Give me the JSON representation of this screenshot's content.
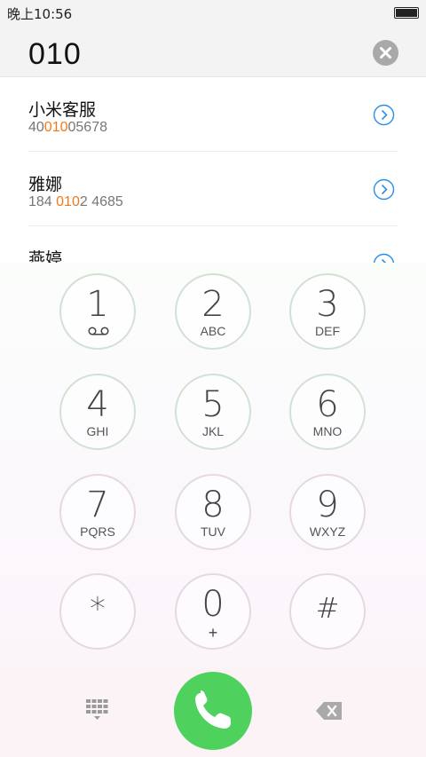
{
  "status_bar": {
    "time": "晚上10:56"
  },
  "dialer": {
    "input": "010"
  },
  "results": [
    {
      "name": "小米客服",
      "number_pre": "40",
      "number_match": "010",
      "number_post": "05678"
    },
    {
      "name": "雅娜",
      "number_pre": "184 ",
      "number_match": "010",
      "number_post": "2 4685"
    },
    {
      "name": "燕婷",
      "number_pre": "",
      "number_match": "",
      "number_post": ""
    }
  ],
  "keypad": [
    {
      "digit": "1",
      "letters": ""
    },
    {
      "digit": "2",
      "letters": "ABC"
    },
    {
      "digit": "3",
      "letters": "DEF"
    },
    {
      "digit": "4",
      "letters": "GHI"
    },
    {
      "digit": "5",
      "letters": "JKL"
    },
    {
      "digit": "6",
      "letters": "MNO"
    },
    {
      "digit": "7",
      "letters": "PQRS"
    },
    {
      "digit": "8",
      "letters": "TUV"
    },
    {
      "digit": "9",
      "letters": "WXYZ"
    },
    {
      "digit": "*",
      "letters": ""
    },
    {
      "digit": "0",
      "letters": "+"
    },
    {
      "digit": "#",
      "letters": ""
    }
  ],
  "icons": {
    "clear": "clear-circle-icon",
    "info": "chevron-right-circle-icon",
    "voicemail": "voicemail-icon",
    "call": "phone-icon",
    "keypad_toggle": "keypad-grid-icon",
    "backspace": "backspace-icon"
  },
  "colors": {
    "accent": "#f07a1b",
    "call": "#4fd15e",
    "info": "#2a8fe8"
  }
}
